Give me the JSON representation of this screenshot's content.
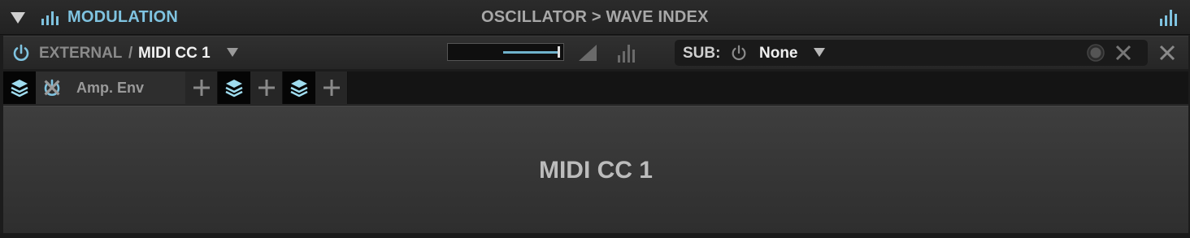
{
  "header": {
    "title": "MODULATION",
    "path": "OSCILLATOR > WAVE INDEX",
    "collapse_icon": "triangle-down-icon",
    "left_icon": "bar-graph-icon",
    "right_icon": "bar-graph-icon"
  },
  "source": {
    "category": "EXTERNAL",
    "separator": "/",
    "name": "MIDI CC 1",
    "power_icon": "power-icon",
    "amount_percent": 48
  },
  "sub": {
    "label": "SUB:",
    "value": "None"
  },
  "tabs": [
    {
      "type": "layer"
    },
    {
      "type": "modulator",
      "label": "Amp. Env",
      "active": true
    },
    {
      "type": "add"
    },
    {
      "type": "layer"
    },
    {
      "type": "add"
    },
    {
      "type": "layer"
    },
    {
      "type": "add"
    }
  ],
  "main": {
    "label": "MIDI CC 1"
  },
  "colors": {
    "accent": "#7fc3e0",
    "background": "#1c1c1c",
    "panel": "#3a3a3a"
  }
}
